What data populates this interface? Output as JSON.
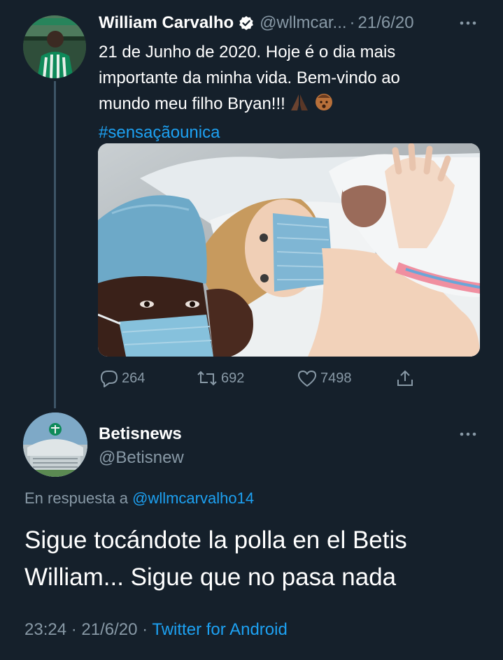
{
  "original_tweet": {
    "author_name": "William Carvalho",
    "handle": "@wllmcar...",
    "separator": "·",
    "date": "21/6/20",
    "text_lines": [
      "21 de Junho de 2020. Hoje é o dia mais",
      "importante da minha vida. Bem-vindo ao",
      "mundo meu filho Bryan!!!"
    ],
    "hashtag": "#sensaçãounica",
    "emojis": [
      "folded-hands-emoji",
      "baby-emoji"
    ],
    "stats": {
      "replies": "264",
      "retweets": "692",
      "likes": "7498"
    }
  },
  "reply_tweet": {
    "author_name": "Betisnews",
    "handle": "@Betisnew",
    "replying_to_prefix": "En respuesta a",
    "replying_to_handle": "@wllmcarvalho14",
    "text_lines": [
      "Sigue tocándote la polla en el Betis",
      "William... Sigue que no pasa nada"
    ],
    "time": "23:24",
    "separator": "·",
    "date": "21/6/20",
    "source": "Twitter for Android"
  },
  "colors": {
    "background": "#15202b",
    "primary_text": "#ffffff",
    "secondary_text": "#8899a6",
    "link": "#1da1f2",
    "thread_line": "#3d5466"
  },
  "icons": [
    "more-icon",
    "verified-badge-icon",
    "reply-icon",
    "retweet-icon",
    "like-icon",
    "share-icon"
  ]
}
